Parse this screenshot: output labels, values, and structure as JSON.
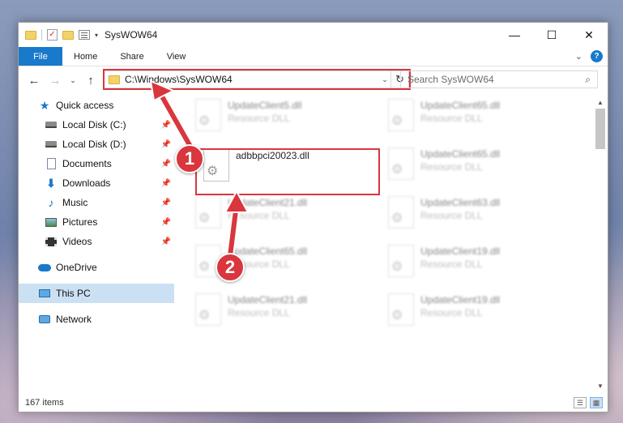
{
  "window": {
    "title": "SysWOW64",
    "minimize": "—",
    "maximize": "☐",
    "close": "✕"
  },
  "ribbon": {
    "tabs": [
      "File",
      "Home",
      "Share",
      "View"
    ],
    "collapse": "⌄",
    "help": "?"
  },
  "nav": {
    "back": "←",
    "forward": "→",
    "recent": "⌄",
    "up": "↑",
    "address": "C:\\Windows\\SysWOW64",
    "address_dropdown": "⌄",
    "refresh": "↻",
    "search_placeholder": "Search SysWOW64",
    "search_icon": "magnifier-icon"
  },
  "sidebar": {
    "quick_access": "Quick access",
    "items": [
      {
        "label": "Local Disk (C:)",
        "icon": "drive-icon",
        "pinned": true
      },
      {
        "label": "Local Disk (D:)",
        "icon": "drive-icon",
        "pinned": true
      },
      {
        "label": "Documents",
        "icon": "documents-icon",
        "pinned": true
      },
      {
        "label": "Downloads",
        "icon": "downloads-icon",
        "pinned": true
      },
      {
        "label": "Music",
        "icon": "music-icon",
        "pinned": true
      },
      {
        "label": "Pictures",
        "icon": "pictures-icon",
        "pinned": true
      },
      {
        "label": "Videos",
        "icon": "videos-icon",
        "pinned": true
      }
    ],
    "onedrive": "OneDrive",
    "this_pc": "This PC",
    "network": "Network"
  },
  "files": {
    "highlighted": {
      "name": "adbbpci20023.dll",
      "type": ""
    },
    "left_column": [
      {
        "name": "UpdateClient5.dll",
        "type": "Resource DLL"
      },
      {
        "name": "UpdateClient21.dll",
        "type": "Resource DLL"
      },
      {
        "name": "UpdateClient65.dll",
        "type": "Resource DLL"
      },
      {
        "name": "UpdateClient21.dll",
        "type": "Resource DLL"
      }
    ],
    "right_column": [
      {
        "name": "UpdateClient65.dll",
        "type": "Resource DLL"
      },
      {
        "name": "UpdateClient65.dll",
        "type": "Resource DLL"
      },
      {
        "name": "UpdateClient63.dll",
        "type": "Resource DLL"
      },
      {
        "name": "UpdateClient19.dll",
        "type": "Resource DLL"
      },
      {
        "name": "UpdateClient19.dll",
        "type": "Resource DLL"
      }
    ]
  },
  "status": {
    "item_count": "167 items"
  },
  "annotations": {
    "step1": "1",
    "step2": "2",
    "color": "#d9363e"
  }
}
